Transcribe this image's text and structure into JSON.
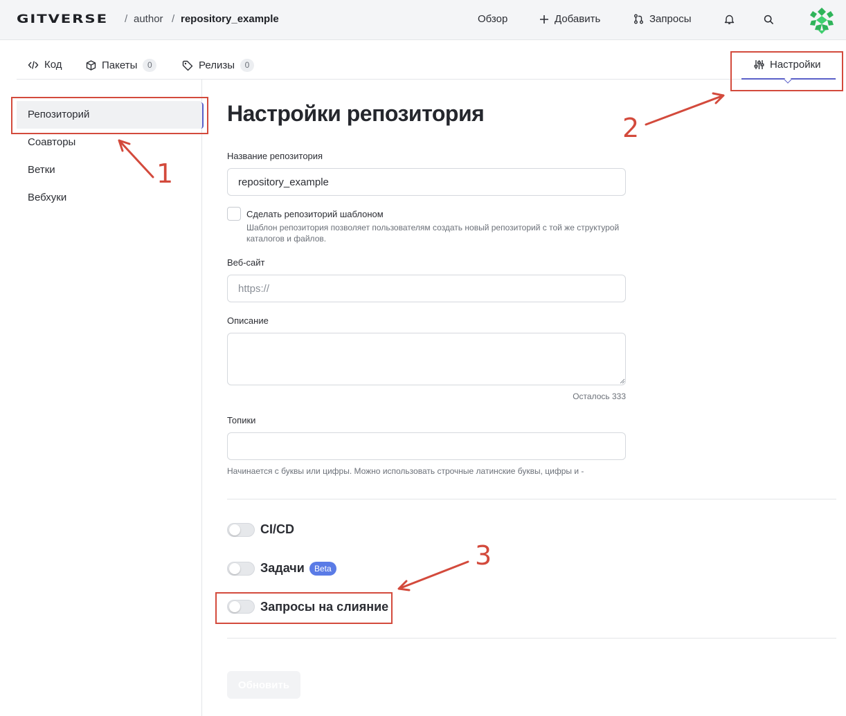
{
  "header": {
    "logo": "GITVERSE",
    "breadcrumb": {
      "sep1": "/",
      "owner": "author",
      "sep2": "/",
      "repo": "repository_example"
    },
    "nav": {
      "overview": "Обзор",
      "add": "Добавить",
      "requests": "Запросы"
    }
  },
  "tabs": {
    "code": "Код",
    "packages": "Пакеты",
    "packages_count": "0",
    "releases": "Релизы",
    "releases_count": "0",
    "settings": "Настройки"
  },
  "sidebar": {
    "items": [
      {
        "label": "Репозиторий"
      },
      {
        "label": "Соавторы"
      },
      {
        "label": "Ветки"
      },
      {
        "label": "Вебхуки"
      }
    ]
  },
  "main": {
    "title": "Настройки репозитория",
    "repo_name_label": "Название репозитория",
    "repo_name_value": "repository_example",
    "template_label": "Сделать репозиторий шаблоном",
    "template_hint": "Шаблон репозитория позволяет пользователям создать новый репозиторий с той же структурой каталогов и файлов.",
    "website_label": "Веб-сайт",
    "website_placeholder": "https://",
    "description_label": "Описание",
    "description_value": "",
    "chars_left": "Осталось 333",
    "topics_label": "Топики",
    "topics_hint": "Начинается с буквы или цифры. Можно использовать строчные латинские буквы, цифры и -",
    "toggles": [
      {
        "label": "CI/CD",
        "enabled": false
      },
      {
        "label": "Задачи",
        "enabled": false,
        "badge": "Beta"
      },
      {
        "label": "Запросы на слияние",
        "enabled": false
      }
    ],
    "submit": "Обновить"
  },
  "annotations": {
    "n1": "1",
    "n2": "2",
    "n3": "3"
  },
  "colors": {
    "accent": "#5a5fc8",
    "annotation": "#d34a3c",
    "badge": "#5a7be6",
    "avatar": "#2fb45a"
  }
}
